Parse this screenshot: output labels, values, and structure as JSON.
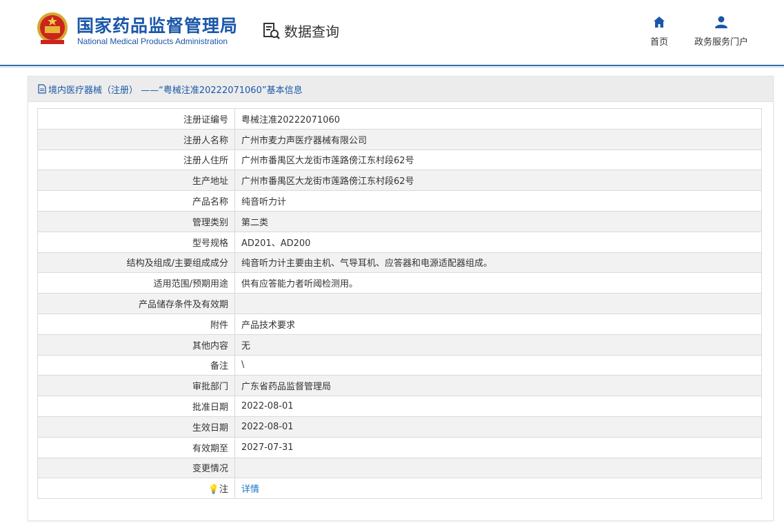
{
  "header": {
    "brand_cn": "国家药品监督管理局",
    "brand_en": "National Medical Products Administration",
    "data_query": "数据查询",
    "nav": [
      {
        "label": "首页",
        "icon": "home-icon"
      },
      {
        "label": "政务服务门户",
        "icon": "user-icon"
      }
    ]
  },
  "panel": {
    "title": "境内医疗器械（注册） ——“粤械注准20222071060”基本信息",
    "rows": [
      {
        "key": "注册证编号",
        "value": "粤械注准20222071060"
      },
      {
        "key": "注册人名称",
        "value": "广州市麦力声医疗器械有限公司"
      },
      {
        "key": "注册人住所",
        "value": "广州市番禺区大龙街市莲路傍江东村段62号"
      },
      {
        "key": "生产地址",
        "value": "广州市番禺区大龙街市莲路傍江东村段62号"
      },
      {
        "key": "产品名称",
        "value": "纯音听力计"
      },
      {
        "key": "管理类别",
        "value": "第二类"
      },
      {
        "key": "型号规格",
        "value": "AD201、AD200"
      },
      {
        "key": "结构及组成/主要组成成分",
        "value": "纯音听力计主要由主机、气导耳机、应答器和电源适配器组成。"
      },
      {
        "key": "适用范围/预期用途",
        "value": "供有应答能力者听阈检测用。"
      },
      {
        "key": "产品储存条件及有效期",
        "value": ""
      },
      {
        "key": "附件",
        "value": "产品技术要求"
      },
      {
        "key": "其他内容",
        "value": "无"
      },
      {
        "key": "备注",
        "value": "\\"
      },
      {
        "key": "审批部门",
        "value": "广东省药品监督管理局"
      },
      {
        "key": "批准日期",
        "value": "2022-08-01"
      },
      {
        "key": "生效日期",
        "value": "2022-08-01"
      },
      {
        "key": "有效期至",
        "value": "2027-07-31"
      },
      {
        "key": "变更情况",
        "value": ""
      }
    ],
    "note_key": "注",
    "note_link": "详情"
  },
  "colors": {
    "brand": "#1a57a8",
    "link": "#1a73c6",
    "header_rule": "#2f6ea8"
  }
}
